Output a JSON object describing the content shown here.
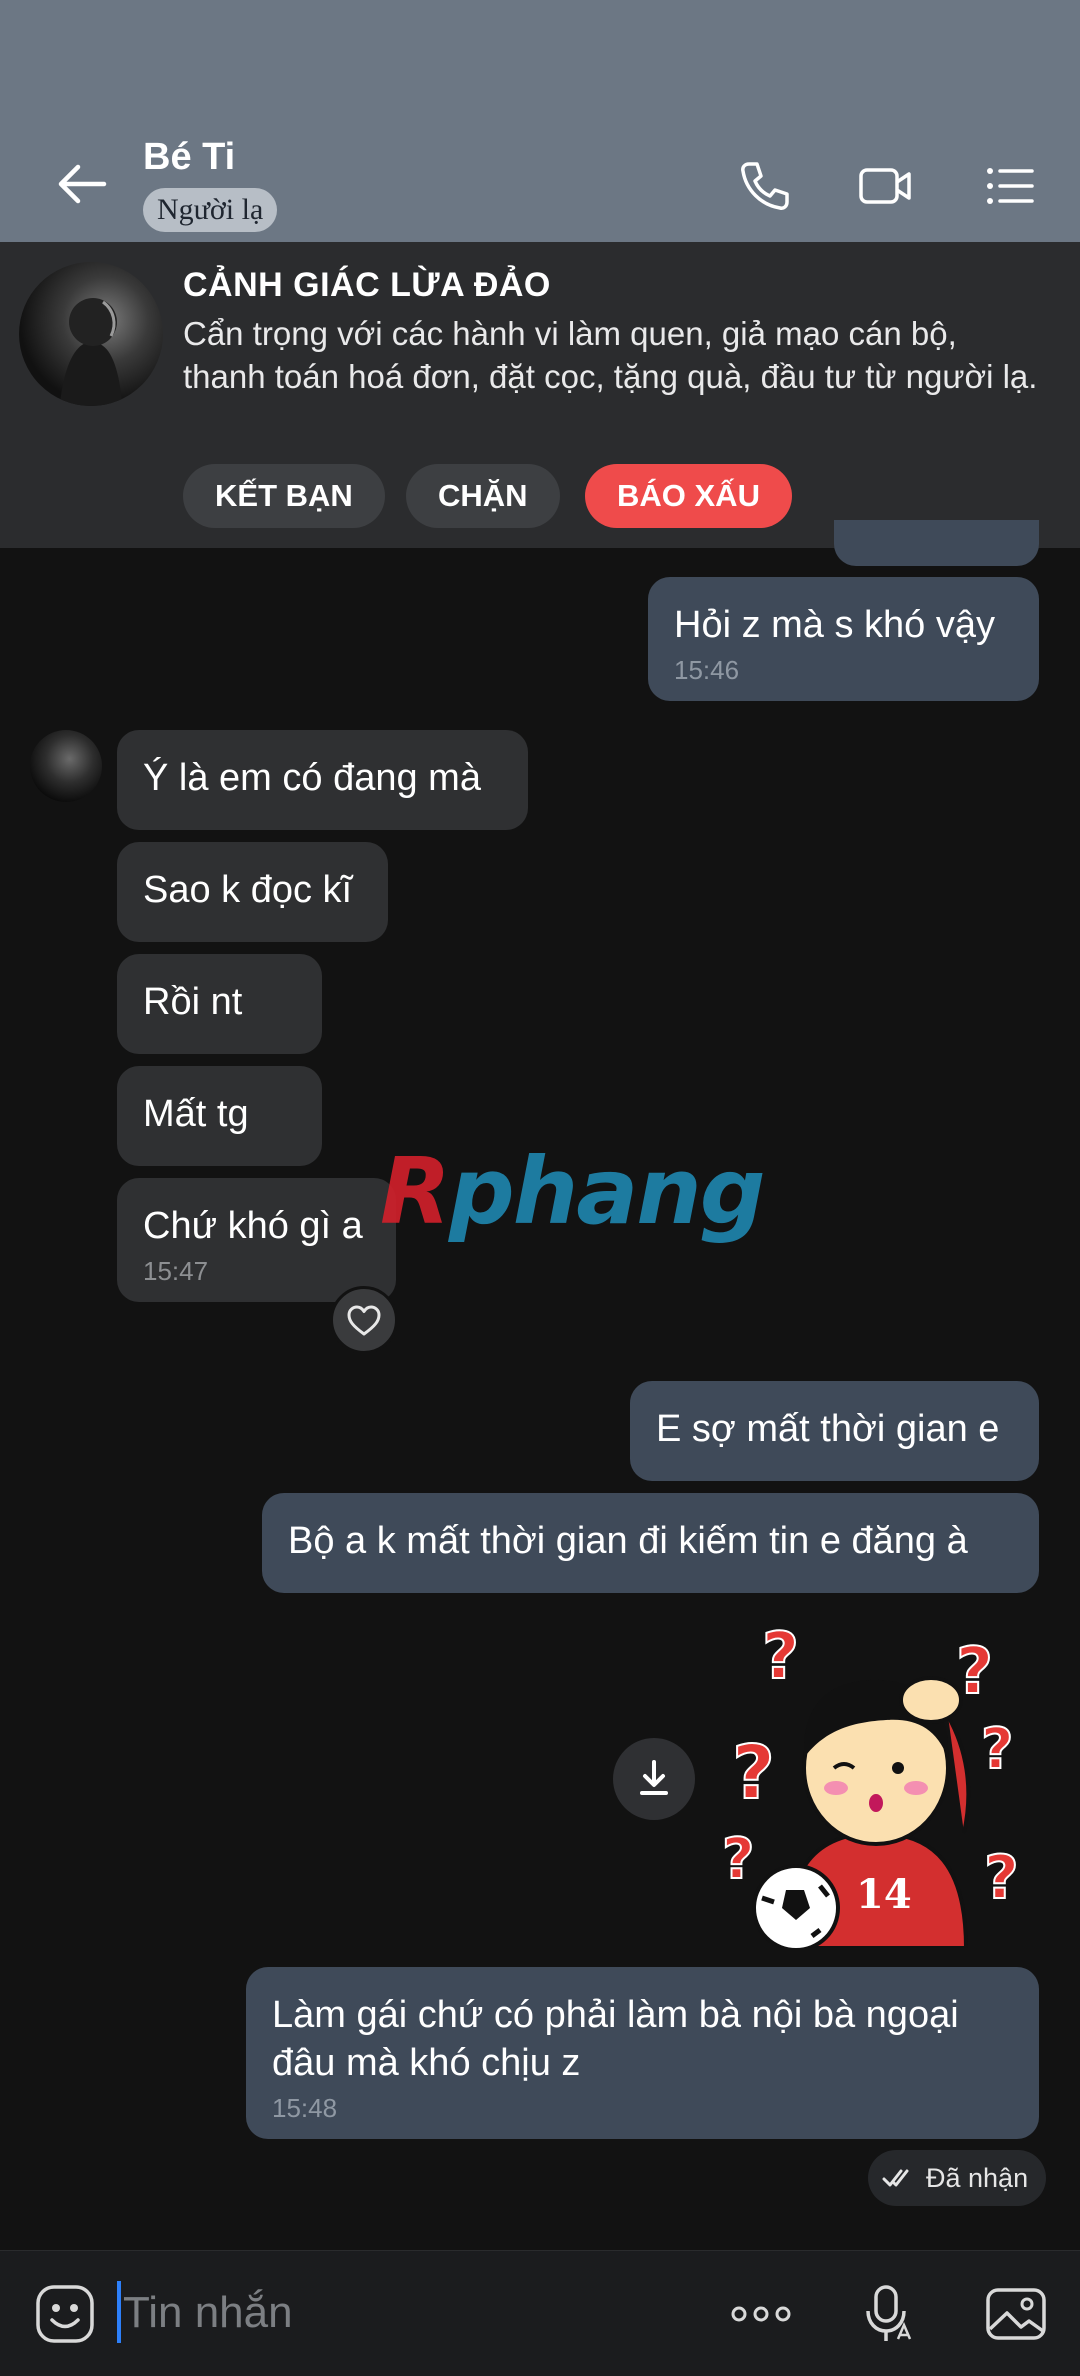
{
  "header": {
    "contact_name": "Bé Ti",
    "badge": "Người lạ"
  },
  "warning": {
    "title": "CẢNH GIÁC LỪA ĐẢO",
    "text": "Cẩn trọng với các hành vi làm quen, giả mạo cán bộ, thanh toán hoá đơn, đặt cọc, tặng quà, đầu tư từ người lạ.",
    "buttons": [
      "KẾT BẠN",
      "CHẶN",
      "BÁO XẤU"
    ]
  },
  "messages": [
    {
      "side": "out",
      "text": "Hỏi z mà s khó vậy",
      "time": "15:46"
    },
    {
      "side": "in",
      "text": "Ý là em có đang mà",
      "time": ""
    },
    {
      "side": "in",
      "text": "Sao k đọc kĩ",
      "time": ""
    },
    {
      "side": "in",
      "text": "Rồi nt",
      "time": ""
    },
    {
      "side": "in",
      "text": "Mất tg",
      "time": ""
    },
    {
      "side": "in",
      "text": "Chứ khó gì a",
      "time": "15:47"
    },
    {
      "side": "out",
      "text": "E sợ mất thời gian e",
      "time": ""
    },
    {
      "side": "out",
      "text": "Bộ a k mất thời gian đi kiếm tin e đăng à",
      "time": ""
    },
    {
      "side": "out",
      "text": "Làm gái chứ có phải làm bà nội bà ngoại đâu mà khó chịu z",
      "time": "15:48"
    }
  ],
  "sticker": {
    "jersey_number": "14"
  },
  "delivery_status": "Đã nhận",
  "watermark": {
    "first": "R",
    "rest": "phang"
  },
  "input": {
    "placeholder": "Tin nhắn"
  },
  "colors": {
    "header_bg": "#6c7784",
    "outgoing_bubble": "#3f4a59",
    "incoming_bubble": "#2f3032",
    "report_button": "#ef4b4b",
    "caret": "#2d7ff9"
  }
}
